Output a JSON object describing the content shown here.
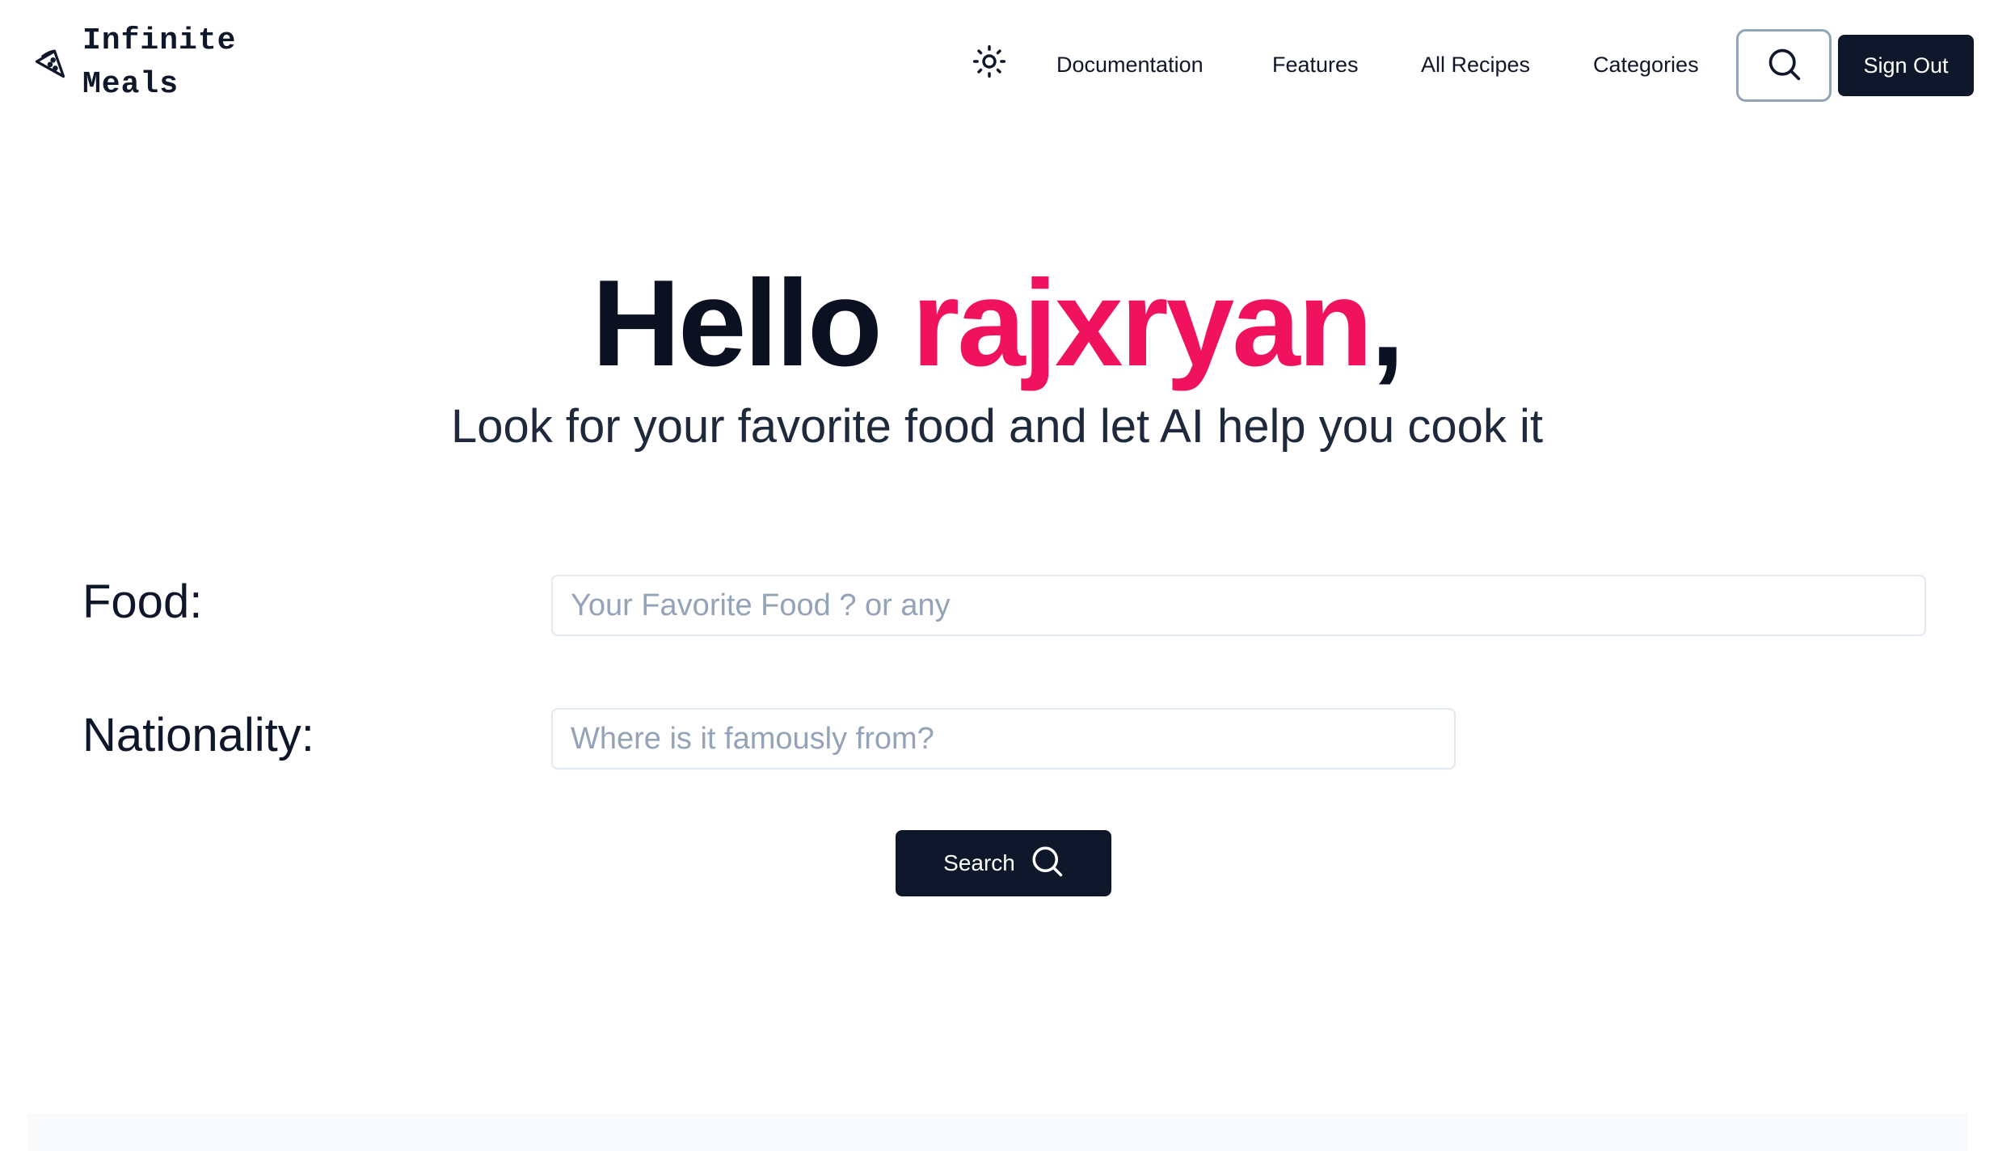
{
  "app": {
    "name": "Infinite\nMeals",
    "logo_icon": "pizza-slice-icon"
  },
  "nav": {
    "theme_icon": "sun-icon",
    "links": [
      {
        "label": "Documentation"
      },
      {
        "label": "Features"
      },
      {
        "label": "All Recipes"
      },
      {
        "label": "Categories"
      }
    ],
    "search_icon": "search-icon",
    "sign_out_label": "Sign Out"
  },
  "hero": {
    "greeting": "Hello",
    "username": "rajxryan",
    "comma": ",",
    "subtitle": "Look for your favorite food and let AI help you cook it"
  },
  "form": {
    "food": {
      "label": "Food:",
      "value": "",
      "placeholder": "Your Favorite Food ? or any"
    },
    "nationality": {
      "label": "Nationality:",
      "value": "",
      "placeholder": "Where is it famously from?"
    },
    "search_button_label": "Search",
    "search_button_icon": "search-icon"
  },
  "colors": {
    "primary_dark": "#0f172a",
    "accent_pink": "#f0125e",
    "placeholder_gray": "#94a3b8",
    "border_gray": "#e2e8f0"
  }
}
